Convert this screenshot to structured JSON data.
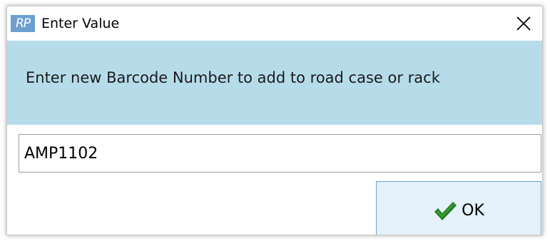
{
  "window": {
    "app_icon_text": "RP",
    "title": "Enter Value",
    "close_icon": "close-icon"
  },
  "prompt": {
    "text": "Enter new Barcode Number to add to road case or rack"
  },
  "input": {
    "value": "AMP1102"
  },
  "buttons": {
    "ok_label": "OK",
    "ok_icon": "checkmark-icon"
  },
  "colors": {
    "banner": "#b6dcea",
    "app_icon": "#6f9fd1",
    "ok_button_bg": "#e5f1fb",
    "ok_button_border": "#6a9fd4",
    "checkmark": "#1f7a1f"
  }
}
